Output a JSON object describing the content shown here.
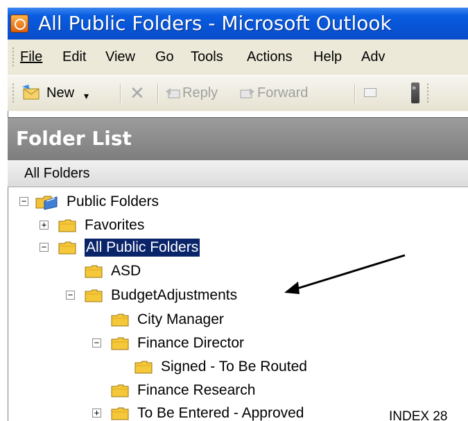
{
  "window": {
    "title": "All Public Folders - Microsoft Outlook"
  },
  "menu": {
    "items": [
      "File",
      "Edit",
      "View",
      "Go",
      "Tools",
      "Actions",
      "Help",
      "Adv"
    ]
  },
  "toolbar": {
    "new_label": "New",
    "reply_label": "Reply",
    "forward_label": "Forward"
  },
  "panel": {
    "title": "Folder List",
    "subheader": "All Folders"
  },
  "tree": {
    "root": "Public Folders",
    "favorites": "Favorites",
    "all_public": "All Public Folders",
    "asd": "ASD",
    "budget": "BudgetAdjustments",
    "city_manager": "City Manager",
    "finance_director": "Finance Director",
    "signed": "Signed - To Be Routed",
    "finance_research": "Finance Research",
    "to_be_entered": "To Be Entered - Approved"
  },
  "expanders": {
    "collapse": "−",
    "expand": "+"
  },
  "footer": {
    "index_text": "INDEX 28"
  },
  "colors": {
    "title_bar": "#0a5de0",
    "selection": "#0a246a",
    "folder": "#f5c83a",
    "panel_header": "#8c8c8c",
    "chrome": "#ece9d8"
  }
}
